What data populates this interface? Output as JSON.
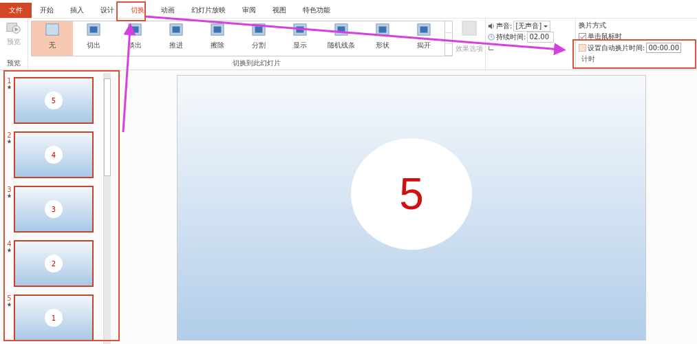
{
  "menu_tabs": [
    {
      "label": "文件",
      "kind": "file",
      "selected": false
    },
    {
      "label": "开始",
      "kind": "tab",
      "selected": false
    },
    {
      "label": "插入",
      "kind": "tab",
      "selected": false
    },
    {
      "label": "设计",
      "kind": "tab",
      "selected": false
    },
    {
      "label": "切换",
      "kind": "tab",
      "selected": true
    },
    {
      "label": "动画",
      "kind": "tab",
      "selected": false
    },
    {
      "label": "幻灯片放映",
      "kind": "tab",
      "selected": false
    },
    {
      "label": "审阅",
      "kind": "tab",
      "selected": false
    },
    {
      "label": "视图",
      "kind": "tab",
      "selected": false
    },
    {
      "label": "特色功能",
      "kind": "tab",
      "selected": false
    }
  ],
  "preview_group": {
    "button": "预览",
    "group_label": "预览"
  },
  "transitions": [
    {
      "label": "无",
      "selected": true
    },
    {
      "label": "切出",
      "selected": false
    },
    {
      "label": "淡出",
      "selected": false
    },
    {
      "label": "推进",
      "selected": false
    },
    {
      "label": "擦除",
      "selected": false
    },
    {
      "label": "分割",
      "selected": false
    },
    {
      "label": "显示",
      "selected": false
    },
    {
      "label": "随机线条",
      "selected": false
    },
    {
      "label": "形状",
      "selected": false
    },
    {
      "label": "揭开",
      "selected": false
    }
  ],
  "transitions_group_label": "切换到此幻灯片",
  "effect_options": {
    "label": "效果选项",
    "disabled": true
  },
  "timing": {
    "sound": {
      "label": "声音:",
      "value": "[无声音]"
    },
    "duration": {
      "label": "持续时间:",
      "value": "02.00"
    }
  },
  "advance": {
    "title": "换片方式",
    "on_click": {
      "label": "单击鼠标时",
      "checked": true
    },
    "auto": {
      "label": "设置自动换片时间:",
      "checked": false,
      "value": "00:00.00"
    },
    "group_label": "计时"
  },
  "slides": [
    {
      "number": "1",
      "circle": "5"
    },
    {
      "number": "2",
      "circle": "4"
    },
    {
      "number": "3",
      "circle": "3"
    },
    {
      "number": "4",
      "circle": "2"
    },
    {
      "number": "5",
      "circle": "1"
    }
  ],
  "current_slide": {
    "circle": "5"
  }
}
